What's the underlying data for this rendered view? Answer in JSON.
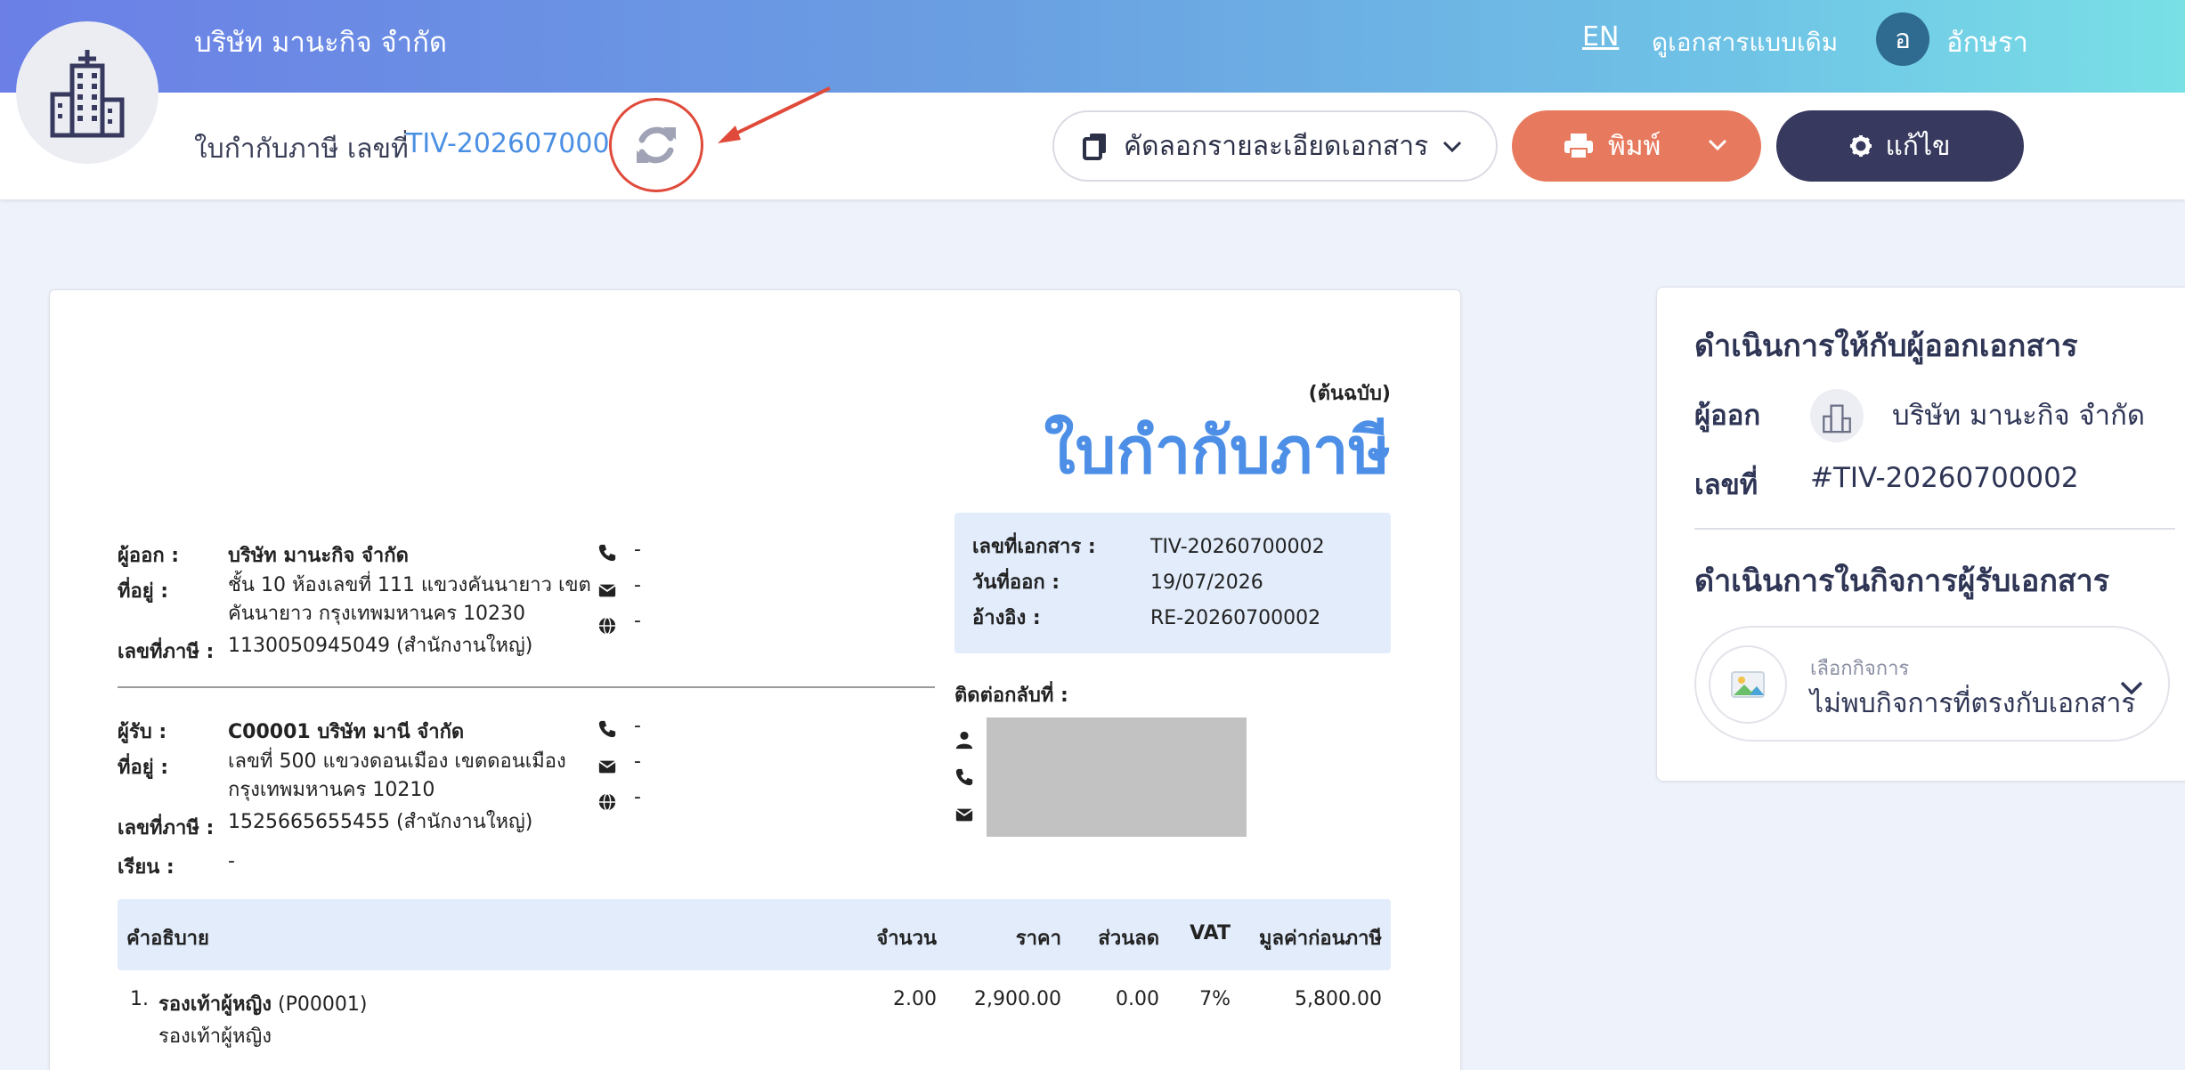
{
  "header": {
    "company_name": "บริษัท มานะกิจ จำกัด",
    "lang_link": "EN",
    "old_view_link": "ดูเอกสารแบบเดิม",
    "avatar_initial": "อ",
    "user_name": "อักษรา"
  },
  "toolbar": {
    "doc_type_label": "ใบกำกับภาษี เลขที่",
    "doc_number": "TIV-20260700002",
    "copy_label": "คัดลอกรายละเอียดเอกสาร",
    "print_label": "พิมพ์",
    "edit_label": "แก้ไข"
  },
  "document": {
    "original_tag": "(ต้นฉบับ)",
    "title": "ใบกำกับภาษี",
    "issuer": {
      "issuer_label": "ผู้ออก :",
      "name": "บริษัท มานะกิจ จำกัด",
      "address_label": "ที่อยู่ :",
      "address_line1": "ชั้น 10 ห้องเลขที่ 111 แขวงคันนายาว เขต",
      "address_line2": "คันนายาว กรุงเทพมหานคร 10230",
      "tax_label": "เลขที่ภาษี :",
      "tax_id": "1130050945049 (สำนักงานใหญ่)",
      "phone": "-",
      "email": "-",
      "web": "-"
    },
    "recipient": {
      "recipient_label": "ผู้รับ :",
      "name": "C00001 บริษัท มานี จำกัด",
      "address_label": "ที่อยู่ :",
      "address_line1": "เลขที่ 500  แขวงดอนเมือง เขตดอนเมือง",
      "address_line2": "กรุงเทพมหานคร 10210",
      "tax_label": "เลขที่ภาษี :",
      "tax_id": "1525665655455 (สำนักงานใหญ่)",
      "attn_label": "เรียน :",
      "attn": "-",
      "phone": "-",
      "email": "-",
      "web": "-"
    },
    "info": {
      "doc_no_label": "เลขที่เอกสาร :",
      "doc_no": "TIV-20260700002",
      "date_label": "วันที่ออก :",
      "date": "19/07/2026",
      "ref_label": "อ้างอิง :",
      "ref": "RE-20260700002"
    },
    "contact_title": "ติดต่อกลับที่ :",
    "table": {
      "headers": {
        "desc": "คำอธิบาย",
        "qty": "จำนวน",
        "price": "ราคา",
        "discount": "ส่วนลด",
        "vat": "VAT",
        "pretax": "มูลค่าก่อนภาษี"
      },
      "rows": [
        {
          "index": "1.",
          "name": "รองเท้าผู้หญิง",
          "code": "(P00001)",
          "subtitle": "รองเท้าผู้หญิง",
          "qty": "2.00",
          "price": "2,900.00",
          "discount": "0.00",
          "vat": "7%",
          "pretax": "5,800.00"
        }
      ]
    }
  },
  "side_panel": {
    "issuer_section_title": "ดำเนินการให้กับผู้ออกเอกสาร",
    "issuer_label": "ผู้ออก",
    "issuer_name": "บริษัท มานะกิจ จำกัด",
    "number_label": "เลขที่",
    "number_value": "#TIV-20260700002",
    "recipient_section_title": "ดำเนินการในกิจการผู้รับเอกสาร",
    "select_label": "เลือกกิจการ",
    "select_value": "ไม่พบกิจการที่ตรงกับเอกสาร"
  },
  "colors": {
    "accent_blue": "#4d8fe6",
    "print_orange": "#e77a5e",
    "edit_navy": "#37395e",
    "annotation_red": "#e04a3a"
  }
}
